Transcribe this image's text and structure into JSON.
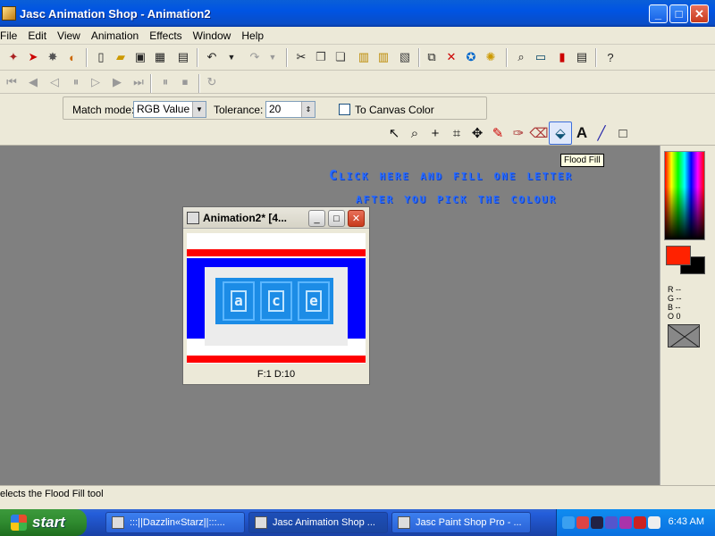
{
  "window": {
    "title": "Jasc Animation Shop - Animation2",
    "minimize": "_",
    "maximize": "□",
    "close": "✕"
  },
  "menu": [
    "File",
    "Edit",
    "View",
    "Animation",
    "Effects",
    "Window",
    "Help"
  ],
  "options": {
    "match_mode_label": "Match mode:",
    "match_mode_value": "RGB Value",
    "tolerance_label": "Tolerance:",
    "tolerance_value": "20",
    "to_canvas_label": "To Canvas Color"
  },
  "tooltip": "Flood Fill",
  "instructions": {
    "line1": "Click here and fill one letter",
    "line2": "after you pick the colour"
  },
  "child_window": {
    "title": "Animation2* [4...",
    "letters": [
      "a",
      "c",
      "e"
    ],
    "frame_info": "F:1   D:10"
  },
  "color_panel": {
    "r": "R --",
    "g": "G --",
    "b": "B --",
    "o": "O 0",
    "foreground": "#ff2200",
    "background": "#000000"
  },
  "status": "elects the Flood Fill tool",
  "taskbar": {
    "start": "start",
    "tasks": [
      ":::||Dazzlin«Starz||:::...",
      "Jasc Animation Shop ...",
      "Jasc Paint Shop Pro - ..."
    ],
    "clock": "6:43 AM"
  }
}
